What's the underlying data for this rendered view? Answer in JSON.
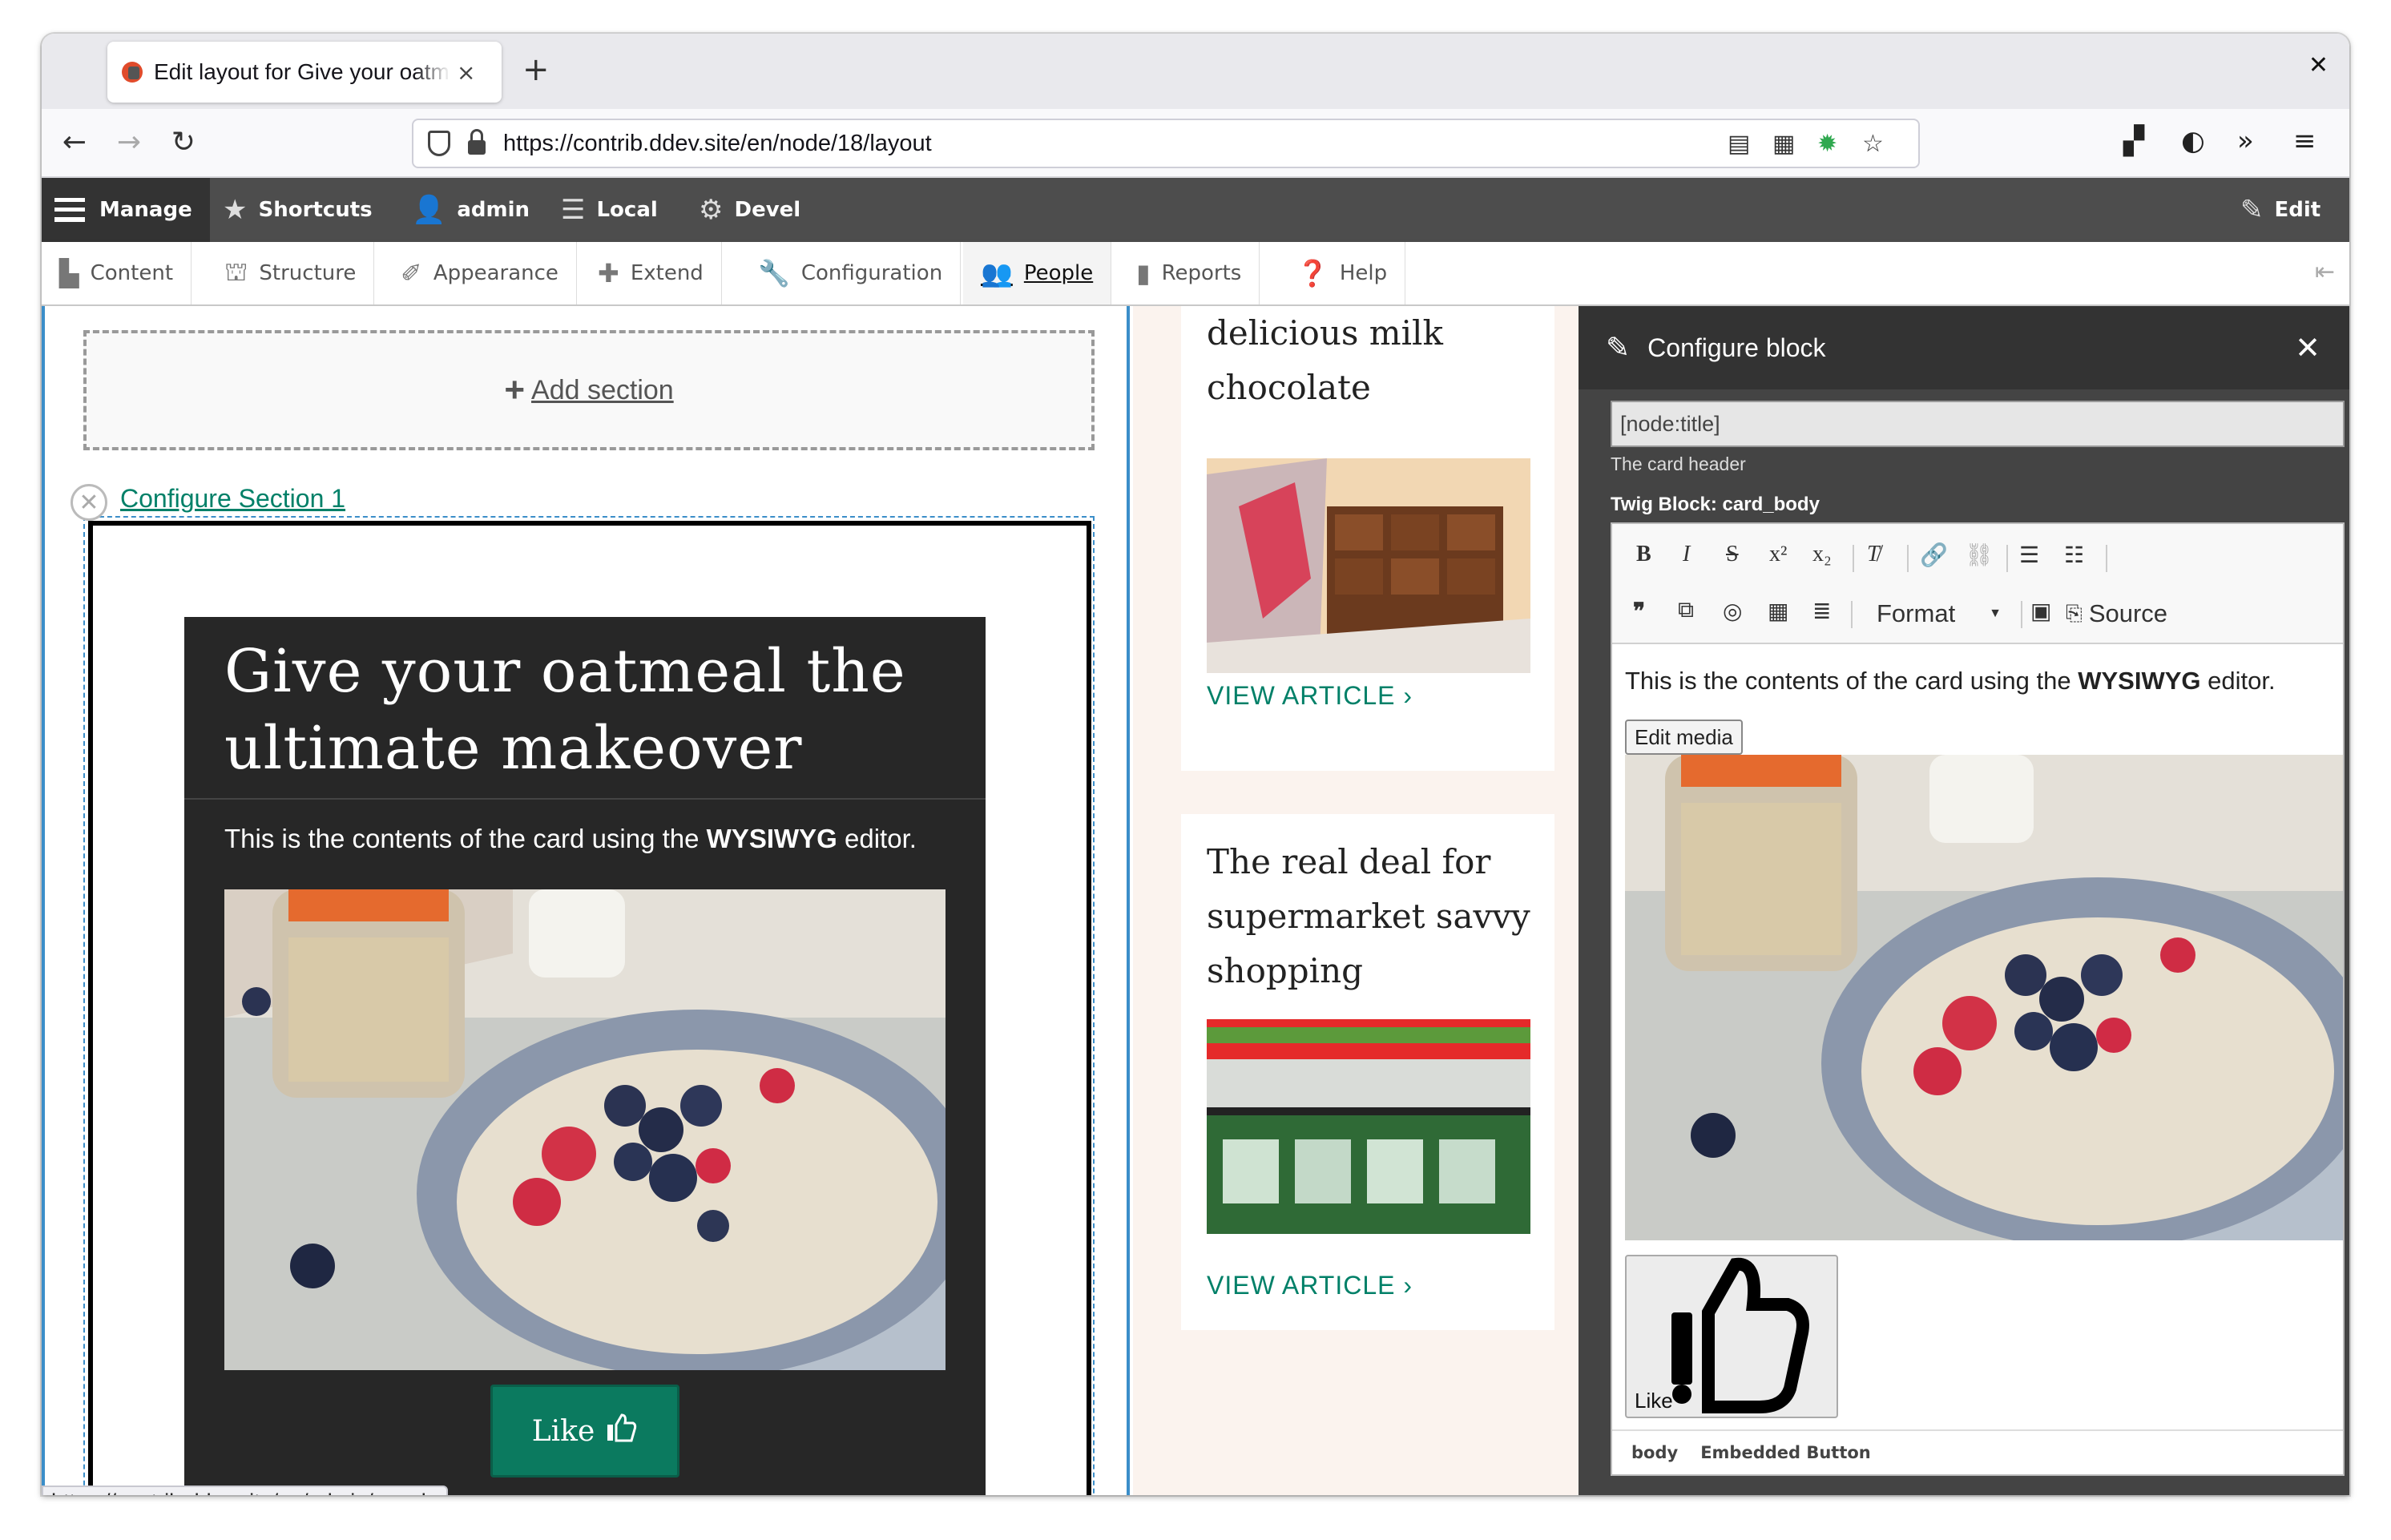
{
  "browser": {
    "tab_title": "Edit layout for Give your oatmeal the ultimate makeover",
    "tab_close": "×",
    "new_tab": "+",
    "window_close": "✕",
    "url": "https://contrib.ddev.site/en/node/18/layout"
  },
  "admin_toolbar": {
    "manage": "Manage",
    "shortcuts": "Shortcuts",
    "user": "admin",
    "local": "Local",
    "devel": "Devel",
    "edit": "Edit"
  },
  "tray": {
    "items": [
      {
        "label": "Content",
        "icon": "file-icon"
      },
      {
        "label": "Structure",
        "icon": "sitemap-icon"
      },
      {
        "label": "Appearance",
        "icon": "paintbrush-icon"
      },
      {
        "label": "Extend",
        "icon": "puzzle-icon"
      },
      {
        "label": "Configuration",
        "icon": "wrench-icon"
      },
      {
        "label": "People",
        "icon": "people-icon"
      },
      {
        "label": "Reports",
        "icon": "bar-chart-icon"
      },
      {
        "label": "Help",
        "icon": "help-icon"
      }
    ]
  },
  "layout_builder": {
    "add_section": "Add section",
    "configure_section": "Configure Section 1"
  },
  "card": {
    "title": "Give your oatmeal the ultimate makeover",
    "body_prefix": "This is the contents of the card using the ",
    "body_bold": "WYSIWYG",
    "body_suffix": " editor.",
    "like_label": "Like"
  },
  "status_url": "https://contrib.ddev.site/en/admin/people",
  "articles": [
    {
      "title": "delicious milk chocolate",
      "link": "VIEW ARTICLE"
    },
    {
      "title": "The real deal for supermarket savvy shopping",
      "link": "VIEW ARTICLE"
    }
  ],
  "offcanvas": {
    "title": "Configure block",
    "close": "✕",
    "input_value": "[node:title]",
    "input_description": "The card header",
    "editor_label": "Twig Block: card_body",
    "format_label": "Format",
    "source_label": "Source",
    "editor_text_prefix": "This is the contents of the card using the ",
    "editor_text_bold": "WYSIWYG",
    "editor_text_suffix": " editor.",
    "edit_media": "Edit media",
    "embed_label": "Like",
    "path": [
      "body",
      "Embedded Button"
    ]
  },
  "colors": {
    "accent_green": "#008068",
    "like_button": "#0b7a5f",
    "admin_bar": "#4d4d4d",
    "layout_outline": "#3b8ec9"
  }
}
